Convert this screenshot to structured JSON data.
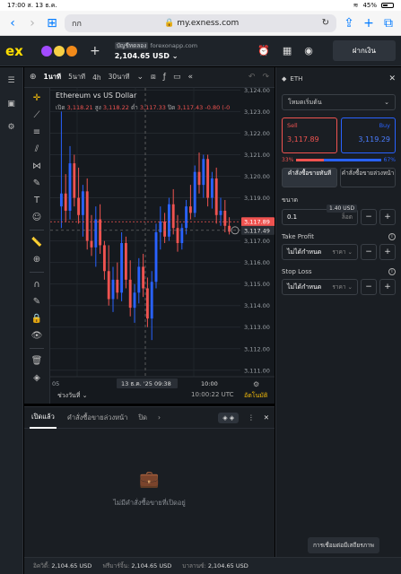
{
  "status": {
    "time": "17:00",
    "date": "ส. 13 ธ.ค.",
    "battery": "45%"
  },
  "browser": {
    "tab_label": "กก",
    "host": "my.exness.com"
  },
  "header": {
    "logo": "ex",
    "account_tag": "บัญชีทดลอง",
    "account_server": "forexonapp.com",
    "balance": "2,104.65 USD",
    "deposit_label": "ฝากเงิน"
  },
  "toolbar": {
    "tf_active": "1นาที",
    "tf_5m": "5นาที",
    "tf_4h": "4h",
    "tf_30m": "30นาที"
  },
  "chart": {
    "title": "Ethereum vs US Dollar",
    "o_label": "เปิด",
    "o": "3,118.21",
    "h_label": "สูง",
    "h": "3,118.22",
    "l_label": "ต่ำ",
    "l": "3,117.33",
    "c_label": "ปิด",
    "c": "3,117.43",
    "chg": "-0.80 (-0",
    "current_price": "3,117.89",
    "cross_price": "3,117.49",
    "ranges_label": "ช่วงวันที่",
    "clock": "10:00:22 UTC",
    "autoscale": "อัตโนมัติ",
    "cross_time": "13 ธ.ค. '25  09:38",
    "x_first": "05",
    "x_1000": "10:00"
  },
  "chart_data": {
    "type": "candlestick",
    "title": "Ethereum vs US Dollar",
    "y_ticks": [
      "3,124.00",
      "3,123.00",
      "3,122.00",
      "3,121.00",
      "3,120.00",
      "3,119.00",
      "3,118.00",
      "3,117.00",
      "3,116.00",
      "3,115.00",
      "3,114.00",
      "3,113.00",
      "3,112.00",
      "3,111.00"
    ],
    "ylim": [
      3110.7,
      3124.1
    ],
    "candles": [
      [
        3118.6,
        3123.0,
        3117.6,
        3119.2
      ],
      [
        3119.2,
        3120.1,
        3117.9,
        3118.4
      ],
      [
        3118.4,
        3121.4,
        3118.0,
        3120.6
      ],
      [
        3120.6,
        3121.0,
        3118.6,
        3119.0
      ],
      [
        3119.0,
        3120.4,
        3117.8,
        3118.2
      ],
      [
        3118.2,
        3119.6,
        3117.2,
        3119.3
      ],
      [
        3119.3,
        3119.9,
        3116.6,
        3117.0
      ],
      [
        3117.0,
        3118.2,
        3116.3,
        3116.7
      ],
      [
        3116.7,
        3118.6,
        3115.8,
        3118.0
      ],
      [
        3118.0,
        3118.7,
        3116.4,
        3116.8
      ],
      [
        3116.8,
        3117.0,
        3115.2,
        3115.6
      ],
      [
        3115.6,
        3116.8,
        3114.0,
        3114.3
      ],
      [
        3114.3,
        3115.8,
        3113.7,
        3115.2
      ],
      [
        3115.2,
        3116.0,
        3114.3,
        3114.6
      ],
      [
        3114.6,
        3117.4,
        3114.2,
        3116.9
      ],
      [
        3116.9,
        3117.2,
        3114.8,
        3115.2
      ],
      [
        3115.2,
        3116.1,
        3113.5,
        3113.9
      ],
      [
        3113.9,
        3115.0,
        3113.2,
        3114.6
      ],
      [
        3114.6,
        3116.2,
        3114.1,
        3115.8
      ],
      [
        3115.8,
        3116.4,
        3114.4,
        3114.8
      ],
      [
        3114.8,
        3115.3,
        3113.0,
        3113.4
      ],
      [
        3113.4,
        3115.6,
        3112.4,
        3115.1
      ],
      [
        3115.1,
        3117.8,
        3114.8,
        3117.4
      ],
      [
        3117.4,
        3118.6,
        3116.6,
        3117.9
      ],
      [
        3117.9,
        3118.3,
        3116.9,
        3117.2
      ],
      [
        3117.2,
        3119.0,
        3117.0,
        3118.7
      ],
      [
        3118.7,
        3119.4,
        3117.3,
        3117.6
      ],
      [
        3117.6,
        3118.2,
        3116.5,
        3116.9
      ],
      [
        3116.9,
        3117.8,
        3116.6,
        3117.6
      ],
      [
        3117.6,
        3118.9,
        3117.3,
        3118.6
      ],
      [
        3118.6,
        3119.6,
        3118.0,
        3118.3
      ],
      [
        3118.3,
        3120.5,
        3118.1,
        3120.2
      ],
      [
        3120.2,
        3121.1,
        3119.2,
        3119.6
      ],
      [
        3119.6,
        3121.0,
        3119.0,
        3120.8
      ],
      [
        3120.8,
        3121.0,
        3118.6,
        3119.0
      ],
      [
        3119.0,
        3120.2,
        3118.5,
        3119.9
      ],
      [
        3119.9,
        3120.4,
        3117.8,
        3118.2
      ],
      [
        3118.2,
        3119.0,
        3117.7,
        3118.4
      ],
      [
        3118.4,
        3118.9,
        3117.4,
        3117.7
      ],
      [
        3117.7,
        3118.1,
        3117.3,
        3117.43
      ]
    ]
  },
  "order": {
    "symbol": "ETH",
    "mode": "โหมดเริ่มต้น",
    "sell_label": "Sell",
    "sell_price": "3,117.89",
    "buy_label": "Buy",
    "buy_price": "3,119.29",
    "spread": "1.40 USD",
    "sell_pct": "33%",
    "buy_pct": "67%",
    "type_market": "คำสั่งซื้อขายทันที",
    "type_pending": "คำสั่งซื้อขายล่วงหน้า",
    "volume_label": "ขนาด",
    "volume": "0.1",
    "volume_unit": "ล็อต",
    "tp_label": "Take Profit",
    "tp_value": "ไม่ได้กำหนด",
    "tp_unit": "ราคา",
    "sl_label": "Stop Loss",
    "sl_value": "ไม่ได้กำหนด",
    "sl_unit": "ราคา"
  },
  "bottom": {
    "tab_open": "เปิดแล้ว",
    "tab_pending": "คำสั่งซื้อขายล่วงหน้า",
    "tab_closed": "ปิด",
    "empty_text": "ไม่มีคำสั่งซื้อขายที่เปิดอยู่",
    "connect": "การเชื่อมต่อมีเสถียรภาพ"
  },
  "footer": {
    "equity_label": "อิควิตี้:",
    "equity": "2,104.65 USD",
    "free_margin_label": "ฟรีมาร์จิ้น:",
    "free_margin": "2,104.65 USD",
    "balance_label": "บาลานซ์:",
    "balance": "2,104.65 USD"
  },
  "colors": {
    "up": "#2962ff",
    "down": "#ef5350",
    "accent": "#ffde02"
  }
}
